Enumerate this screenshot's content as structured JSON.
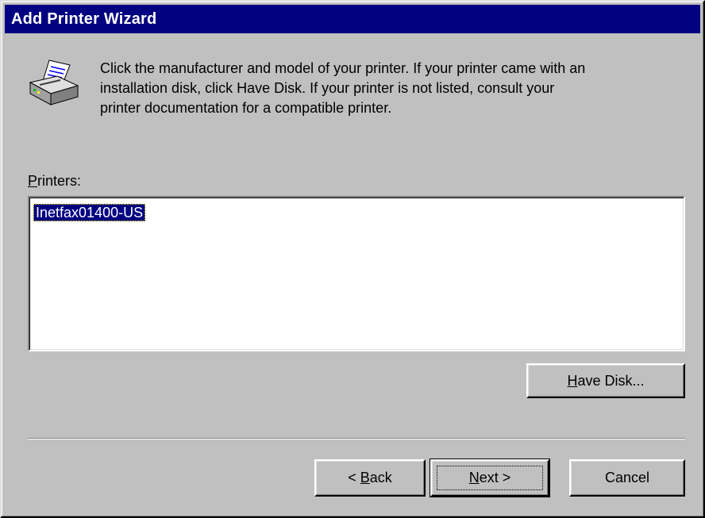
{
  "window": {
    "title": "Add Printer Wizard"
  },
  "instructions": {
    "line1": "Click the manufacturer and model of your printer.  If your printer came with an",
    "line2": "installation disk, click Have Disk.  If your printer is not listed, consult your",
    "line3": "printer documentation for a compatible printer."
  },
  "printers": {
    "label_mnemonic": "P",
    "label_rest": "rinters:",
    "items": [
      "Inetfax01400-US"
    ],
    "selected_index": 0
  },
  "buttons": {
    "have_disk": {
      "mnemonic": "H",
      "rest": "ave Disk..."
    },
    "back": {
      "prefix": "< ",
      "mnemonic": "B",
      "rest": "ack"
    },
    "next": {
      "mnemonic": "N",
      "rest": "ext >"
    },
    "cancel": {
      "label": "Cancel"
    }
  },
  "colors": {
    "titlebar": "#000080",
    "face": "#c0c0c0",
    "selection": "#000080"
  },
  "icons": {
    "wizard": "printer-icon"
  }
}
